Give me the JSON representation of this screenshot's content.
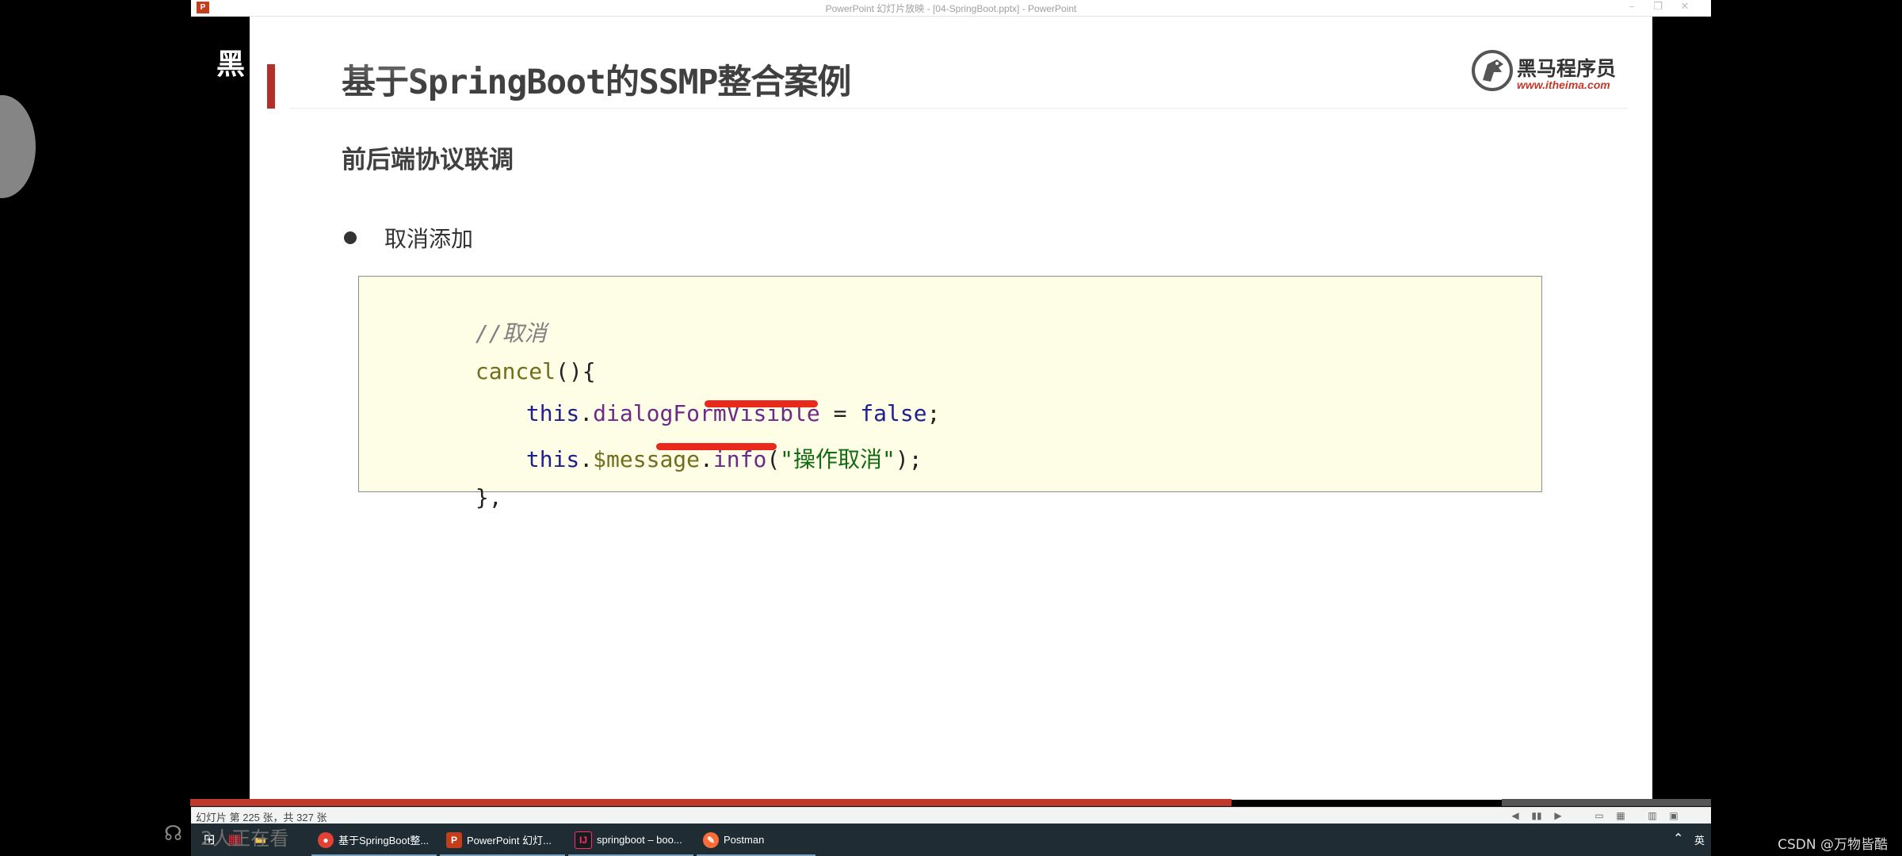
{
  "window": {
    "title": "PowerPoint 幻灯片放映 - [04-SpringBoot.pptx] - PowerPoint",
    "app_icon_letter": "P",
    "controls": {
      "minimize": "–",
      "restore": "❐",
      "close": "✕"
    }
  },
  "slide": {
    "title": "基于SpringBoot的SSMP整合案例",
    "logo": {
      "text": "黑马程序员",
      "url": "www.itheima.com"
    },
    "section_heading": "前后端协议联调",
    "bullet": "取消添加",
    "code": {
      "comment": "//取消",
      "line2": {
        "name": "cancel",
        "open": "(){"
      },
      "line3": {
        "kw": "this",
        "dot": ".",
        "prop": "dialogFormVisible",
        "eq": " = ",
        "value": "false",
        "end": ";"
      },
      "line4": {
        "kw": "this",
        "dot1": ".",
        "var": "$message",
        "dot2": ".",
        "method": "info",
        "open": "(",
        "str": "\"操作取消\"",
        "close": ");"
      },
      "line5": "},"
    }
  },
  "progress": {
    "current": 225,
    "total": 327
  },
  "statusbar": {
    "slide_counter": "幻灯片 第 225 张，共 327 张"
  },
  "taskbar": {
    "apps": [
      {
        "label": "基于SpringBoot整...",
        "icon": "chrome-icon",
        "color": "#e34133"
      },
      {
        "label": "PowerPoint 幻灯...",
        "icon": "powerpoint-icon",
        "color": "#c43e1c"
      },
      {
        "label": "springboot – boo...",
        "icon": "intellij-icon",
        "color": "#fc2f74"
      },
      {
        "label": "Postman",
        "icon": "postman-icon",
        "color": "#ff6c37"
      }
    ],
    "ime": "英"
  },
  "overlays": {
    "left_text": "黑",
    "viewer_count": "2人正在看",
    "csdn_watermark": "CSDN @万物皆酷"
  }
}
